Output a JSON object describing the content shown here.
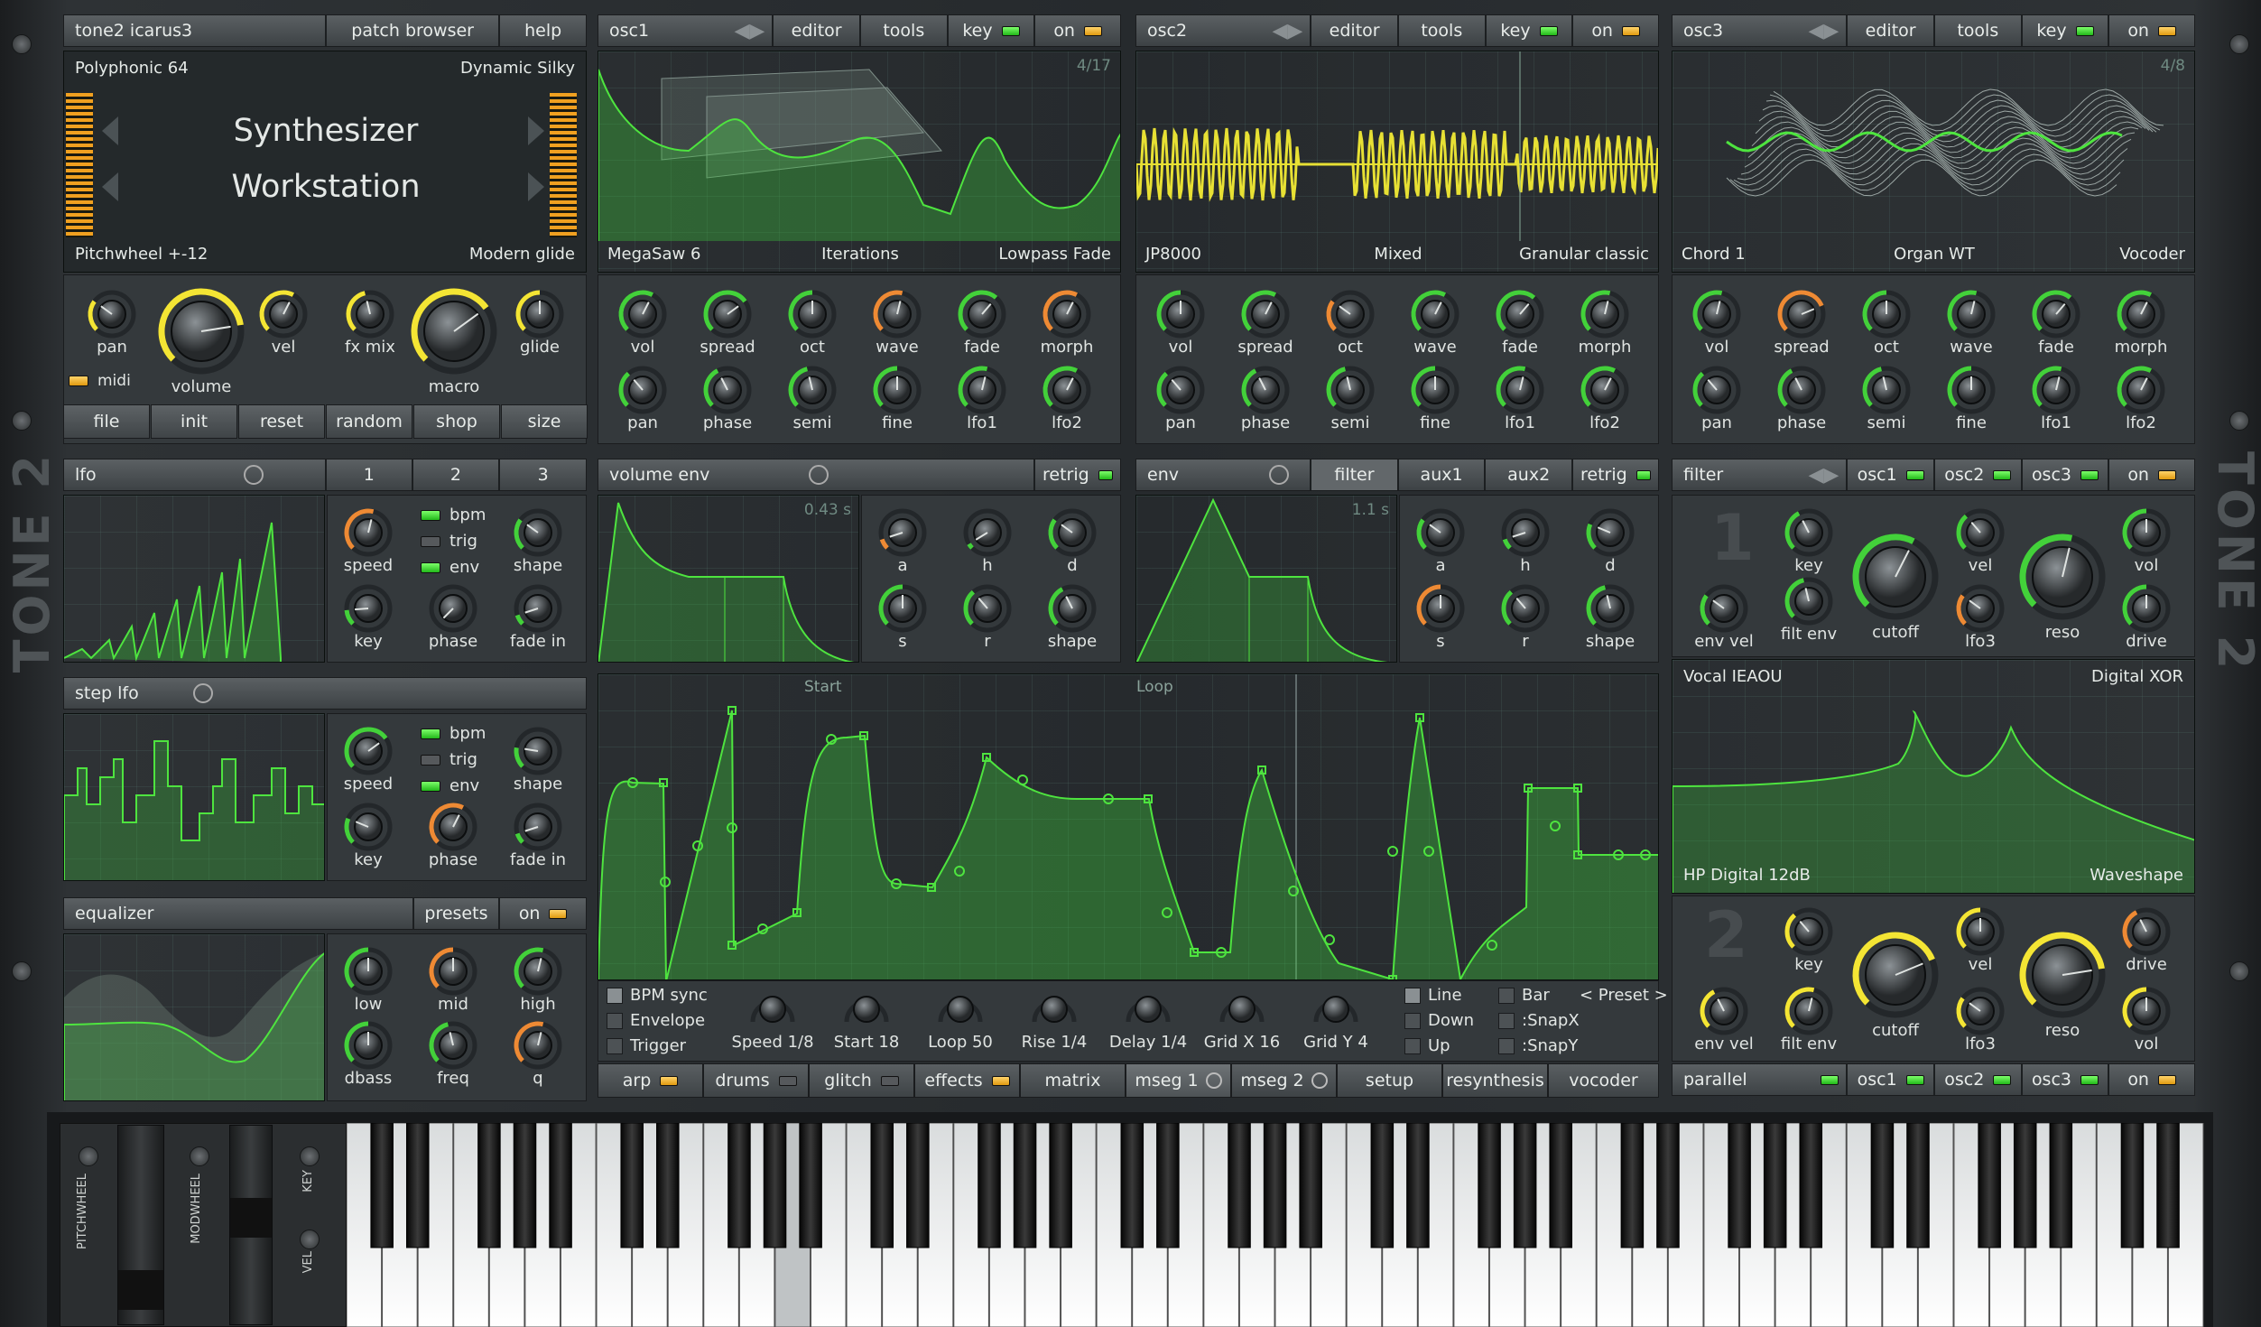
{
  "colors": {
    "accent_green": "#43d13a",
    "accent_yellow": "#f4e534",
    "accent_orange": "#ee8a34",
    "panel": "#34393c",
    "display": "#15211e"
  },
  "patch": {
    "name": "tone2 icarus3",
    "browser": "patch browser",
    "help": "help",
    "preset_left_top": "Polyphonic 64",
    "preset_right_top": "Dynamic Silky",
    "line1": "Synthesizer",
    "line2": "Workstation",
    "bottom_left": "Pitchwheel +-12",
    "bottom_right": "Modern glide"
  },
  "master": {
    "knobs": [
      "pan",
      "volume",
      "vel",
      "fx mix",
      "macro",
      "glide"
    ],
    "midi": "midi",
    "buttons": [
      "file",
      "init",
      "reset",
      "random",
      "shop",
      "size"
    ]
  },
  "osc1": {
    "title": "osc1",
    "editor": "editor",
    "tools": "tools",
    "key": "key",
    "on": "on",
    "counter": "4/17",
    "presets": [
      "MegaSaw 6",
      "Iterations",
      "Lowpass Fade"
    ],
    "knobs_row1": [
      "vol",
      "spread",
      "oct",
      "wave",
      "fade",
      "morph"
    ],
    "knobs_row2": [
      "pan",
      "phase",
      "semi",
      "fine",
      "lfo1",
      "lfo2"
    ]
  },
  "osc2": {
    "title": "osc2",
    "editor": "editor",
    "tools": "tools",
    "key": "key",
    "on": "on",
    "presets": [
      "JP8000",
      "Mixed",
      "Granular classic"
    ],
    "knobs_row1": [
      "vol",
      "spread",
      "oct",
      "wave",
      "fade",
      "morph"
    ],
    "knobs_row2": [
      "pan",
      "phase",
      "semi",
      "fine",
      "lfo1",
      "lfo2"
    ]
  },
  "osc3": {
    "title": "osc3",
    "editor": "editor",
    "tools": "tools",
    "key": "key",
    "on": "on",
    "counter": "4/8",
    "presets": [
      "Chord 1",
      "Organ WT",
      "Vocoder"
    ],
    "knobs_row1": [
      "vol",
      "spread",
      "oct",
      "wave",
      "fade",
      "morph"
    ],
    "knobs_row2": [
      "pan",
      "phase",
      "semi",
      "fine",
      "lfo1",
      "lfo2"
    ]
  },
  "lfo": {
    "title": "lfo",
    "tabs": [
      "1",
      "2",
      "3"
    ],
    "knobs": [
      "speed",
      "shape",
      "key",
      "phase",
      "fade in"
    ],
    "toggles": [
      "bpm",
      "trig",
      "env"
    ]
  },
  "step_lfo": {
    "title": "step lfo",
    "knobs": [
      "speed",
      "shape",
      "key",
      "phase",
      "fade in"
    ],
    "toggles": [
      "bpm",
      "trig",
      "env"
    ]
  },
  "equalizer": {
    "title": "equalizer",
    "presets": "presets",
    "on": "on",
    "knobs": [
      "low",
      "mid",
      "high",
      "dbass",
      "freq",
      "q"
    ]
  },
  "volume_env": {
    "title": "volume env",
    "retrig": "retrig",
    "time": "0.43 s",
    "knobs": [
      "a",
      "h",
      "d",
      "s",
      "r",
      "shape"
    ]
  },
  "env": {
    "title": "env",
    "tabs": [
      "filter",
      "aux1",
      "aux2"
    ],
    "retrig": "retrig",
    "time": "1.1 s",
    "knobs": [
      "a",
      "h",
      "d",
      "s",
      "r",
      "shape"
    ]
  },
  "filter": {
    "title": "filter",
    "osc_tabs": [
      "osc1",
      "osc2",
      "osc3"
    ],
    "on": "on",
    "knobs": [
      "key",
      "vel",
      "vol",
      "env vel",
      "filt env",
      "cutoff",
      "lfo3",
      "reso",
      "drive"
    ],
    "preset_top_left": "Vocal IEAOU",
    "preset_top_right": "Digital XOR",
    "preset_bottom_left": "HP Digital 12dB",
    "preset_bottom_right": "Waveshape"
  },
  "filter2": {
    "number": "2",
    "knobs": [
      "key",
      "vel",
      "drive",
      "env vel",
      "filt env",
      "cutoff",
      "lfo3",
      "reso",
      "vol"
    ],
    "mode": "parallel",
    "osc_tabs": [
      "osc1",
      "osc2",
      "osc3"
    ],
    "on": "on"
  },
  "mseg": {
    "start_label": "Start",
    "loop_label": "Loop",
    "checks": [
      "BPM sync",
      "Envelope",
      "Trigger"
    ],
    "knobs": [
      "Speed 1/8",
      "Start 18",
      "Loop 50",
      "Rise 1/4",
      "Delay 1/4",
      "Grid X 16",
      "Grid Y 4"
    ],
    "modes": [
      "Line",
      "Down",
      "Up"
    ],
    "snap": [
      "Bar",
      ":SnapX",
      ":SnapY"
    ],
    "preset": "< Preset >"
  },
  "tabs_bottom": [
    "arp",
    "drums",
    "glitch",
    "effects",
    "matrix",
    "mseg 1",
    "mseg 2",
    "setup",
    "resynthesis",
    "vocoder"
  ],
  "keyboard": {
    "pitchwheel": "PITCHWHEEL",
    "modwheel": "MODWHEEL",
    "key": "KEY",
    "vel": "VEL"
  },
  "logo": "TONE 2"
}
